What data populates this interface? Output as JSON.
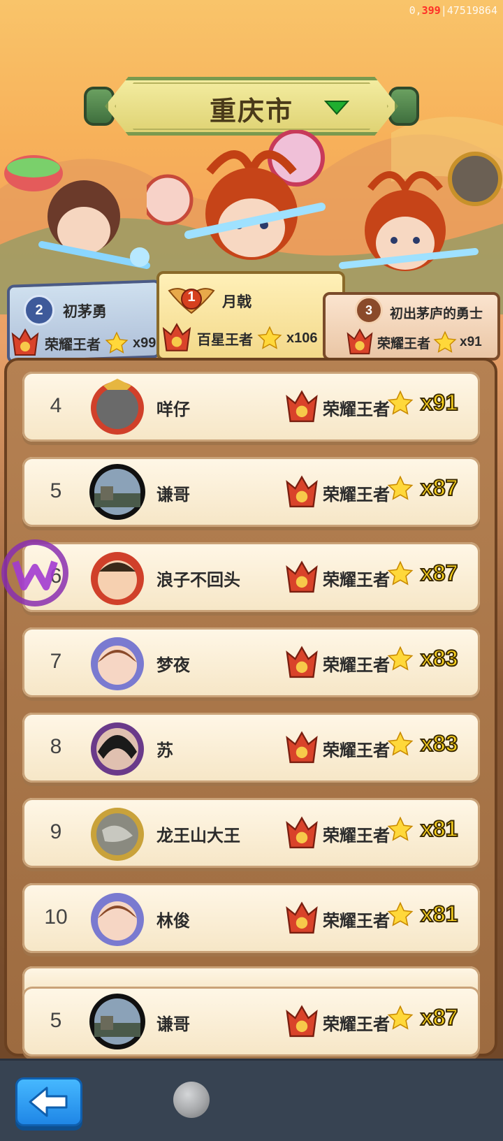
{
  "debug_id": {
    "prefix": "0,",
    "highlight": "399",
    "suffix": "|47519864"
  },
  "region": {
    "title": "重庆市"
  },
  "podium": {
    "first": {
      "rank": "1",
      "name": "月戟",
      "tier": "百星王者",
      "stars": "x106"
    },
    "second": {
      "rank": "2",
      "name": "初茅勇",
      "tier": "荣耀王者",
      "stars": "x99"
    },
    "third": {
      "rank": "3",
      "name": "初出茅庐的勇士",
      "tier": "荣耀王者",
      "stars": "x91"
    }
  },
  "rankings": [
    {
      "rank": "4",
      "name": "咩仔",
      "tier": "荣耀王者",
      "stars": "x91",
      "avatar": "warrior-frame-avatar"
    },
    {
      "rank": "5",
      "name": "谦哥",
      "tier": "荣耀王者",
      "stars": "x87",
      "avatar": "landscape-photo-avatar"
    },
    {
      "rank": "6",
      "name": "浪子不回头",
      "tier": "荣耀王者",
      "stars": "x87",
      "avatar": "cartoon-hero-avatar"
    },
    {
      "rank": "7",
      "name": "梦夜",
      "tier": "荣耀王者",
      "stars": "x83",
      "avatar": "cartoon-girl-avatar"
    },
    {
      "rank": "8",
      "name": "苏",
      "tier": "荣耀王者",
      "stars": "x83",
      "avatar": "photo-avatar"
    },
    {
      "rank": "9",
      "name": "龙王山大王",
      "tier": "荣耀王者",
      "stars": "x81",
      "avatar": "dragon-avatar"
    },
    {
      "rank": "10",
      "name": "林俊",
      "tier": "荣耀王者",
      "stars": "x81",
      "avatar": "cartoon-girl-avatar"
    }
  ],
  "my_rank": {
    "rank": "5",
    "name": "谦哥",
    "tier": "荣耀王者",
    "stars": "x87"
  },
  "colors": {
    "star_text": "#ffd51e",
    "back_button": "#1f86e6",
    "bottom_bar": "#374352"
  },
  "icons": {
    "dropdown": "triangle-down-icon",
    "back": "arrow-left-icon",
    "star": "star-icon",
    "tier": "crown-emblem-icon"
  }
}
